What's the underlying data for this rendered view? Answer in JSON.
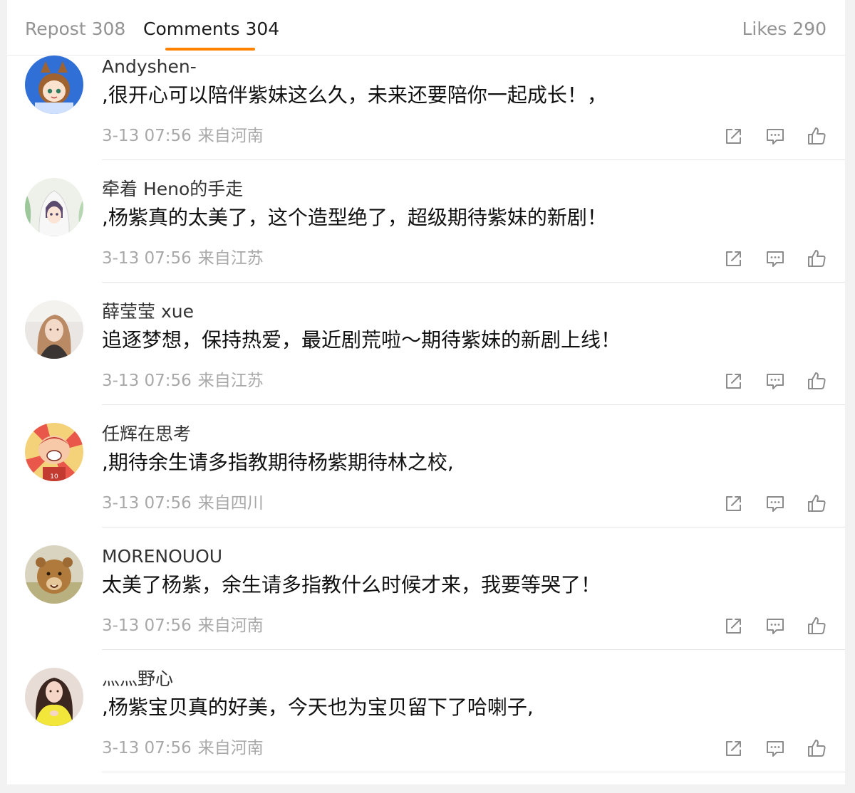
{
  "tabs": {
    "repost": "Repost 308",
    "comments": "Comments 304",
    "likes": "Likes 290"
  },
  "colors": {
    "accent": "#ff8200",
    "text_primary": "#111111",
    "text_secondary": "#a8a8a8"
  },
  "action_icons": [
    "repost-icon",
    "comment-icon",
    "like-icon"
  ],
  "comments": [
    {
      "username": "Andyshen-",
      "text": ",很开心可以陪伴紫妹这么久，未来还要陪你一起成长！，",
      "time": "3-13 07:56",
      "location": "来自河南",
      "avatar_icon": "cartoon-girl-avatar-icon"
    },
    {
      "username": "牵着 Heno的手走",
      "text": ",杨紫真的太美了，这个造型绝了，超级期待紫妹的新剧！",
      "time": "3-13 07:56",
      "location": "来自江苏",
      "avatar_icon": "anime-hoodie-avatar-icon"
    },
    {
      "username": "薛莹莹 xue",
      "text": "追逐梦想，保持热爱，最近剧荒啦～期待紫妹的新剧上线！",
      "time": "3-13 07:56",
      "location": "来自江苏",
      "avatar_icon": "photo-woman-avatar-icon"
    },
    {
      "username": "任辉在思考",
      "text": ",期待余生请多指教期待杨紫期待林之校,",
      "time": "3-13 07:56",
      "location": "来自四川",
      "avatar_icon": "cartoon-player-avatar-icon"
    },
    {
      "username": "MORENOUOU",
      "text": "太美了杨紫，余生请多指教什么时候才来，我要等哭了！",
      "time": "3-13 07:56",
      "location": "来自河南",
      "avatar_icon": "lion-cub-avatar-icon"
    },
    {
      "username": "灬灬野心",
      "text": ",杨紫宝贝真的好美，今天也为宝贝留下了哈喇子,",
      "time": "3-13 07:56",
      "location": "来自河南",
      "avatar_icon": "photo-woman-yellow-avatar-icon"
    }
  ]
}
